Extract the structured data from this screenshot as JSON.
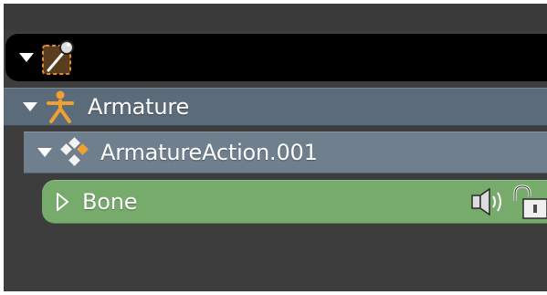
{
  "outliner": {
    "rows": [
      {
        "label": "",
        "icon": "scene-icon",
        "expanded": true
      },
      {
        "label": "Armature",
        "icon": "armature-icon",
        "expanded": true
      },
      {
        "label": "ArmatureAction.001",
        "icon": "action-icon",
        "expanded": true
      },
      {
        "label": "Bone",
        "icon": "bone-group-icon",
        "expanded": false,
        "right_icons": [
          "speaker-icon",
          "unlocked-icon"
        ]
      }
    ]
  },
  "colors": {
    "background": "#3d3d3d",
    "scene_row": "#000000",
    "object_row": "#5c6b7a",
    "action_row": "#707f8e",
    "bone_row": "#77ab6c",
    "accent_orange": "#f0a030",
    "text": "#ffffff"
  }
}
